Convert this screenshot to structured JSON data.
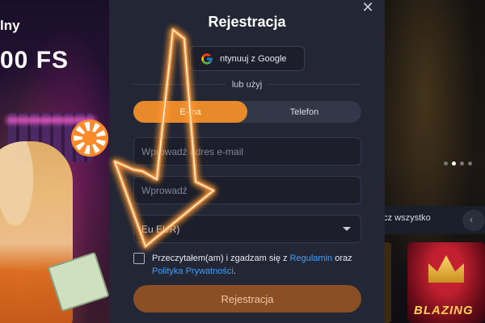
{
  "promo": {
    "line1": "lny",
    "line2": "00 FS"
  },
  "modal": {
    "title": "Rejestracja",
    "close_icon": "close-icon",
    "google_button": "ntynuuj z Google",
    "divider_text": "lub użyj",
    "tabs": [
      {
        "label": "E-ma",
        "active": true
      },
      {
        "label": "Telefon",
        "active": false
      }
    ],
    "email_placeholder": "Wprowadź adres e-mail",
    "password_placeholder": "Wprowadź",
    "currency_value": "Eu     EUR)",
    "consent": {
      "prefix": "Przeczytałem(am) i zgadzam się z ",
      "link1": "Regulamin",
      "middle": " oraz ",
      "link2": "Polityka Prywatności",
      "suffix": "."
    },
    "submit_label": "Rejestracja"
  },
  "right_panel": {
    "see_all": "acz wszystko",
    "nav_icon": "chevron-left-icon",
    "game_label": "BLAZING"
  },
  "colors": {
    "modal_bg": "#232735",
    "accent": "#e98a2a",
    "submit_bg": "#8a4f24",
    "link": "#3aa0ff",
    "neon": "#ff9a3a"
  }
}
